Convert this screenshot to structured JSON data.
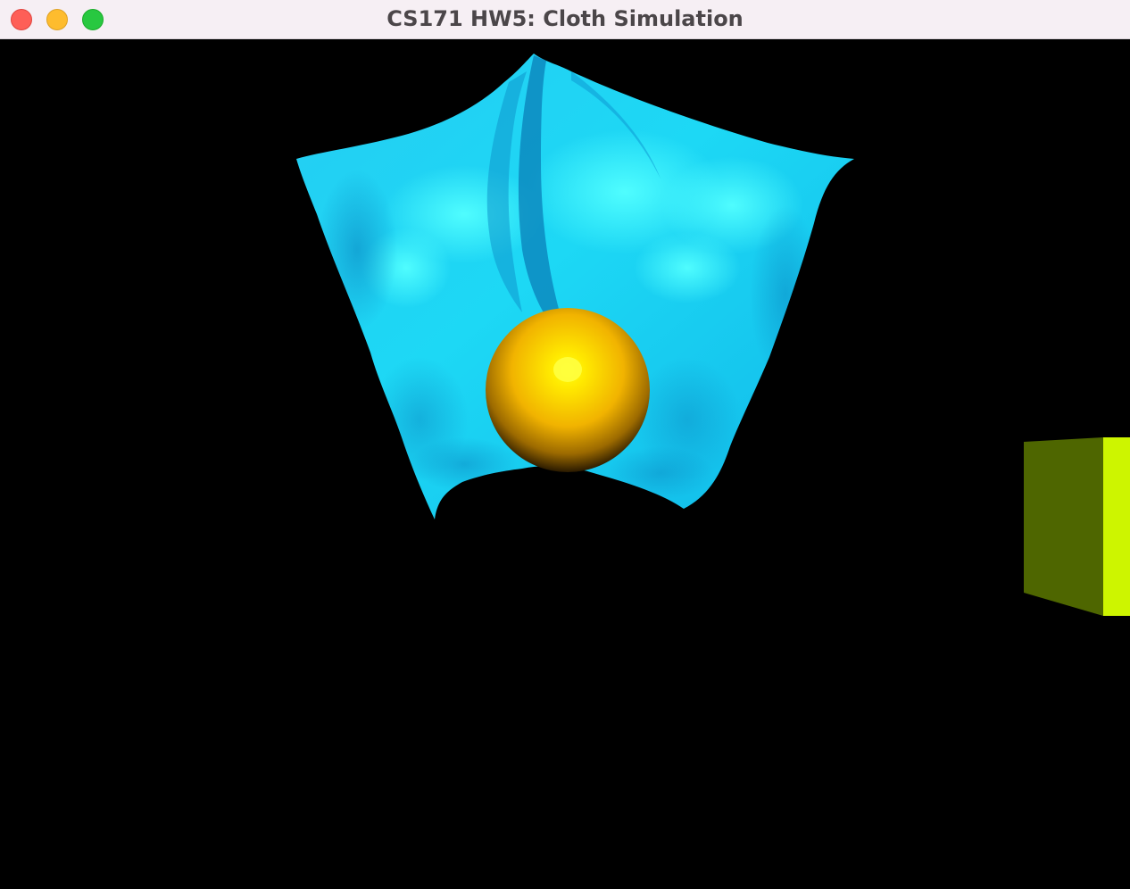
{
  "window": {
    "title": "CS171 HW5: Cloth Simulation",
    "controls": {
      "close": "close-button",
      "minimize": "minimize-button",
      "zoom": "zoom-button"
    }
  },
  "scene": {
    "background_color": "#000000",
    "objects": [
      {
        "name": "cloth",
        "color": "#19c8f0",
        "highlight_color": "#00f4ff"
      },
      {
        "name": "sphere",
        "color": "#f5b800",
        "highlight_color": "#ffff00"
      },
      {
        "name": "cube",
        "front_color": "#cdf500",
        "side_color": "#4e6600"
      }
    ]
  }
}
